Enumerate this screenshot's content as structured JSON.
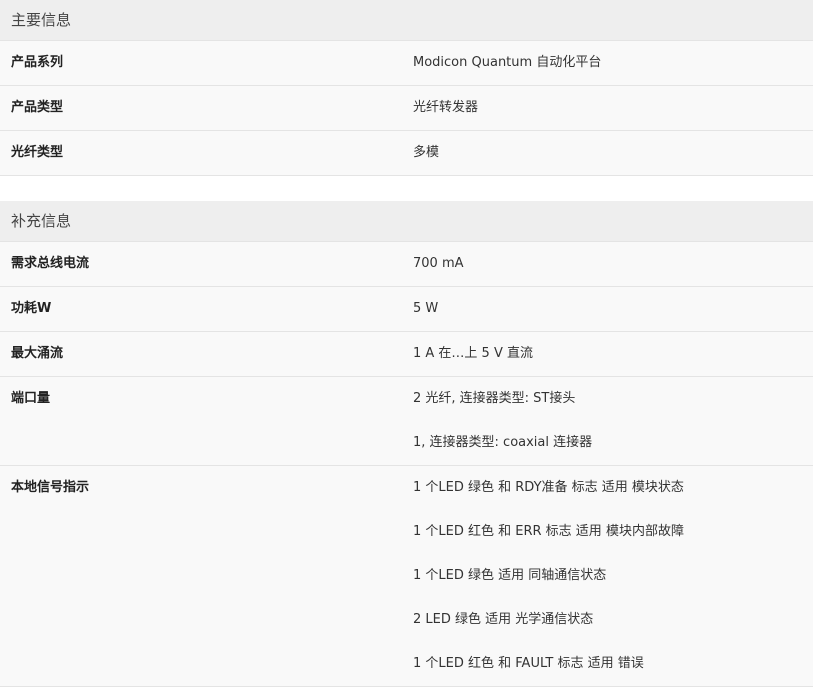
{
  "sections": [
    {
      "title": "主要信息",
      "rows": [
        {
          "label": "产品系列",
          "values": [
            "Modicon Quantum 自动化平台"
          ]
        },
        {
          "label": "产品类型",
          "values": [
            "光纤转发器"
          ]
        },
        {
          "label": "光纤类型",
          "values": [
            "多模"
          ]
        }
      ]
    },
    {
      "title": "补充信息",
      "rows": [
        {
          "label": "需求总线电流",
          "values": [
            "700 mA"
          ]
        },
        {
          "label": "功耗W",
          "values": [
            "5 W"
          ]
        },
        {
          "label": "最大涌流",
          "values": [
            "1 A 在…上 5 V 直流"
          ]
        },
        {
          "label": "端口量",
          "values": [
            "2 光纤, 连接器类型: ST接头",
            "1, 连接器类型: coaxial 连接器"
          ]
        },
        {
          "label": "本地信号指示",
          "values": [
            "1 个LED 绿色 和 RDY准备 标志 适用 模块状态",
            "1 个LED 红色 和 ERR 标志 适用 模块内部故障",
            "1 个LED 绿色 适用 同轴通信状态",
            "2 LED 绿色 适用 光学通信状态",
            "1 个LED 红色 和 FAULT 标志 适用 错误"
          ]
        }
      ]
    }
  ]
}
